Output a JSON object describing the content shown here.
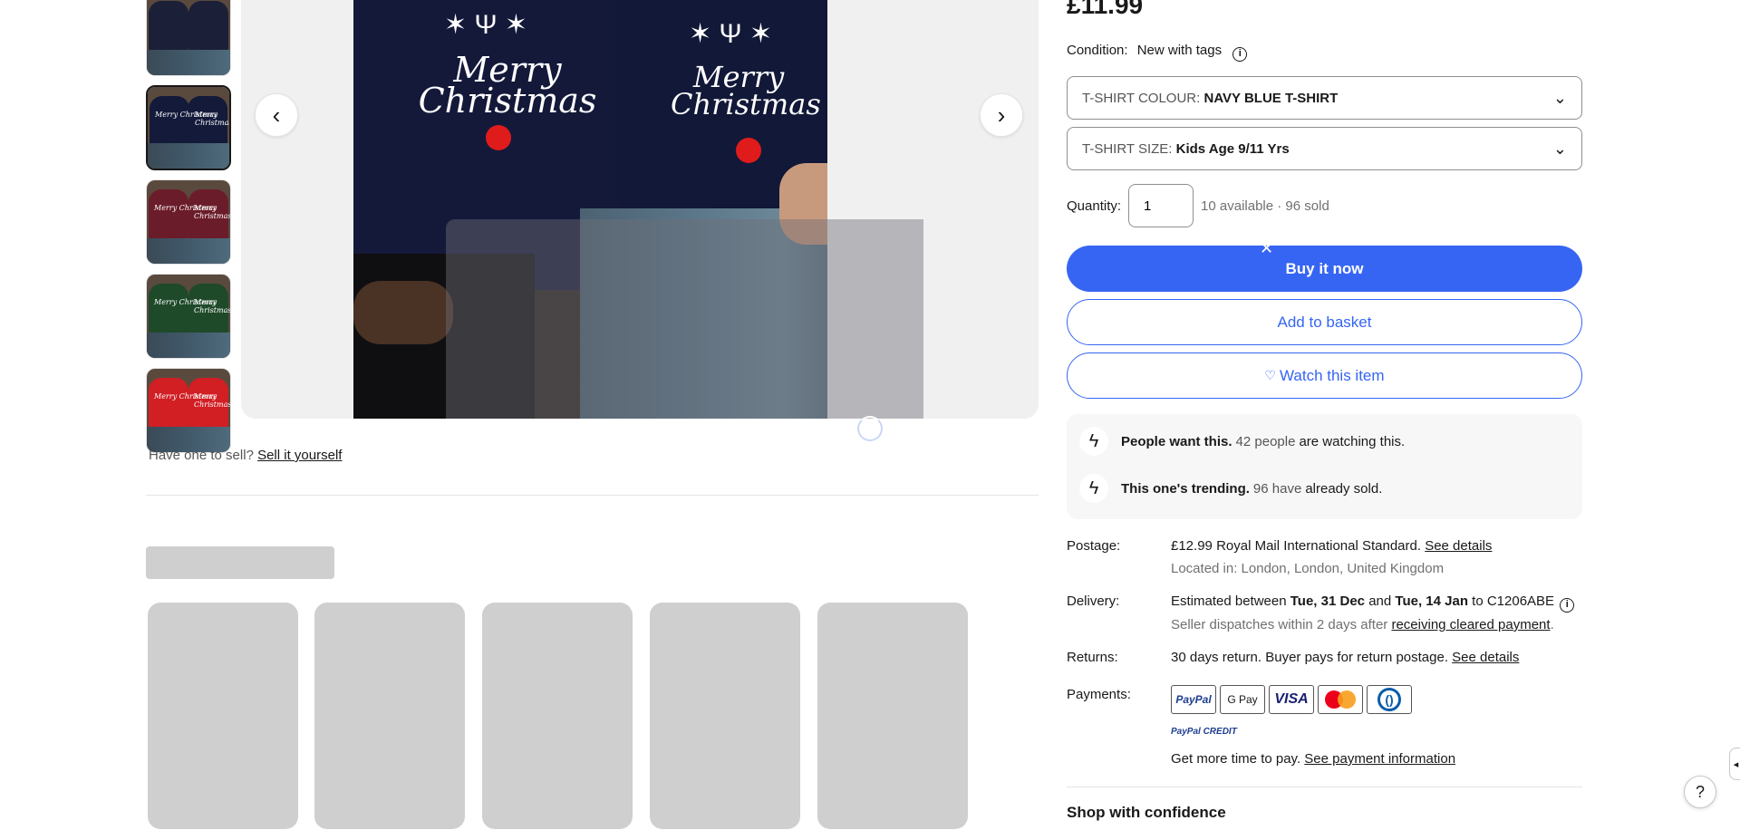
{
  "price": "£11.99",
  "condition": {
    "label": "Condition:",
    "value": "New with tags"
  },
  "variations": [
    {
      "label": "T-SHIRT COLOUR:",
      "value": "NAVY BLUE T-SHIRT"
    },
    {
      "label": "T-SHIRT SIZE:",
      "value": "Kids Age 9/11 Yrs"
    }
  ],
  "quantity": {
    "label": "Quantity:",
    "value": "1",
    "availability": "10 available · 96 sold"
  },
  "buttons": {
    "buy": "Buy it now",
    "basket": "Add to basket",
    "watch": "Watch this item"
  },
  "urgency": [
    {
      "bold": "People want this.",
      "mid": "42 people",
      "tail": "are watching this."
    },
    {
      "bold": "This one's trending.",
      "mid": "96 have",
      "tail": "already sold."
    }
  ],
  "postage": {
    "label": "Postage:",
    "price": "£12.99",
    "service": "Royal Mail International Standard.",
    "link": "See details",
    "location": "Located in: London, London, United Kingdom"
  },
  "delivery": {
    "label": "Delivery:",
    "pre": "Estimated between",
    "from": "Tue, 31 Dec",
    "and": "and",
    "to": "Tue, 14 Jan",
    "dest": "to C1206ABE",
    "dispatch": "Seller dispatches within 2 days after",
    "dispatch_link": "receiving cleared payment",
    "dispatch_end": "."
  },
  "returns": {
    "label": "Returns:",
    "text": "30 days return. Buyer pays for return postage.",
    "link": "See details"
  },
  "payments": {
    "label": "Payments:",
    "methods": [
      "PayPal",
      "G Pay",
      "VISA",
      "mastercard",
      "diners"
    ],
    "credit": "PayPal CREDIT",
    "credit_text": "Get more time to pay.",
    "credit_link": "See payment information"
  },
  "shop_confidence": "Shop with confidence",
  "sell": {
    "text": "Have one to sell?",
    "link": "Sell it yourself"
  },
  "hero": {
    "text_left": "Merry Christmas",
    "text_right": "Merry Christmas"
  },
  "thumbs": [
    {
      "color": "#1b2038",
      "label": "",
      "selected": false
    },
    {
      "color": "#141a3a",
      "label": "Merry Christmas",
      "selected": true
    },
    {
      "color": "#6b1c2a",
      "label": "Merry Christmas",
      "selected": false
    },
    {
      "color": "#1f4a2a",
      "label": "Merry Christmas",
      "selected": false
    },
    {
      "color": "#d11f24",
      "label": "Merry Christmas",
      "selected": false
    }
  ],
  "colors": {
    "accent": "#3665f3"
  },
  "icons": [
    "chevron-left-icon",
    "chevron-right-icon",
    "info-icon",
    "chevron-down-icon",
    "heart-icon",
    "lightning-icon",
    "help-icon"
  ]
}
